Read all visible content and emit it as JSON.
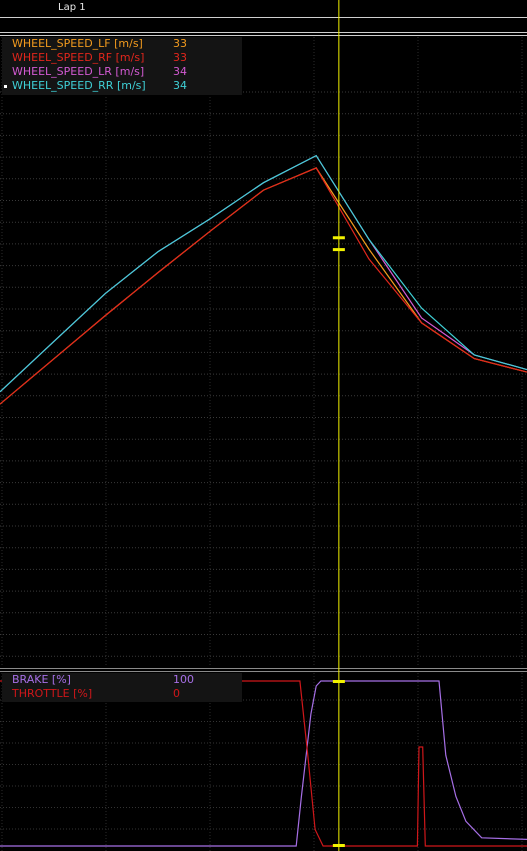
{
  "lap": {
    "label": "Lap 1"
  },
  "cursor_color": "#f2f200",
  "speed_panel": {
    "legend": [
      {
        "name": "WHEEL_SPEED_LF [m/s]",
        "value": "33",
        "color": "#f39b1e",
        "selected": false
      },
      {
        "name": "WHEEL_SPEED_RF [m/s]",
        "value": "33",
        "color": "#e2261c",
        "selected": false
      },
      {
        "name": "WHEEL_SPEED_LR [m/s]",
        "value": "34",
        "color": "#d25ad2",
        "selected": false
      },
      {
        "name": "WHEEL_SPEED_RR [m/s]",
        "value": "34",
        "color": "#3fd0d6",
        "selected": true
      }
    ]
  },
  "pedal_panel": {
    "legend": [
      {
        "name": "BRAKE [%]",
        "value": "100",
        "color": "#a66fe6"
      },
      {
        "name": "THROTTLE [%]",
        "value": "0",
        "color": "#d0171a"
      }
    ]
  },
  "chart_data": [
    {
      "type": "line",
      "title": "",
      "xlabel": "",
      "ylabel": "",
      "grid": true,
      "legend_position": "top-left",
      "x": [
        0,
        10,
        20,
        30,
        40,
        50,
        60,
        70,
        80,
        90,
        100
      ],
      "cursor_x": 64.3,
      "ylim": [
        0,
        50
      ],
      "series": [
        {
          "name": "WHEEL_SPEED_LF [m/s]",
          "color": "#f39b1e",
          "values": [
            20.4,
            24.0,
            27.6,
            31.1,
            34.5,
            37.8,
            39.6,
            33.0,
            27.0,
            24.1,
            23.0
          ]
        },
        {
          "name": "WHEEL_SPEED_RF [m/s]",
          "color": "#e2261c",
          "values": [
            20.4,
            24.0,
            27.6,
            31.1,
            34.5,
            37.8,
            39.6,
            33.0,
            27.0,
            24.1,
            23.0
          ]
        },
        {
          "name": "WHEEL_SPEED_LR [m/s]",
          "color": "#d25ad2",
          "values": [
            21.4,
            25.4,
            29.4,
            32.8,
            35.5,
            38.4,
            40.6,
            33.8,
            27.4,
            24.4,
            23.2
          ]
        },
        {
          "name": "WHEEL_SPEED_RR [m/s]",
          "color": "#3fd0d6",
          "values": [
            21.4,
            25.4,
            29.4,
            32.8,
            35.5,
            38.4,
            40.6,
            33.8,
            27.4,
            24.4,
            23.2
          ]
        }
      ]
    },
    {
      "type": "line",
      "title": "",
      "xlabel": "",
      "ylabel": "",
      "grid": true,
      "legend_position": "top-left",
      "cursor_x": 64.3,
      "ylim": [
        0,
        100
      ],
      "series": [
        {
          "name": "BRAKE [%]",
          "color": "#a66fe6",
          "x": [
            0,
            56.2,
            57.2,
            59.0,
            60.0,
            60.9,
            83.3,
            84.6,
            86.5,
            88.4,
            91.4,
            100
          ],
          "values": [
            0,
            0,
            30,
            80,
            97,
            100,
            100,
            55,
            30,
            15,
            5,
            4
          ]
        },
        {
          "name": "THROTTLE [%]",
          "color": "#d0171a",
          "x": [
            0,
            56.9,
            58.4,
            59.8,
            61.3,
            79.2,
            79.5,
            80.2,
            80.7,
            81.1,
            100
          ],
          "values": [
            100,
            100,
            55,
            10,
            0,
            0,
            60,
            60,
            0,
            0,
            0
          ]
        }
      ]
    }
  ]
}
